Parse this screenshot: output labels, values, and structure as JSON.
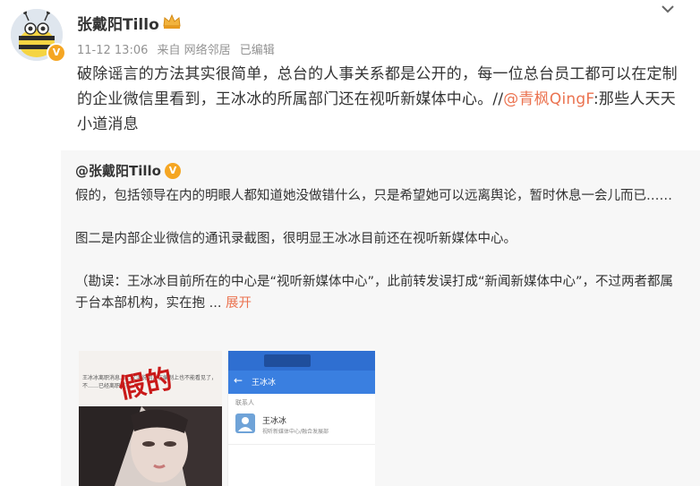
{
  "post": {
    "username": "张戴阳Tillo",
    "timestamp": "11-12 13:06",
    "source": "来自 网络邻居",
    "edited": "已编辑",
    "text_main": "破除谣言的方法其实很简单，总台的人事关系都是公开的，每一位总台员工都可以在定制的企业微信里看到，王冰冰的所属部门还在视听新媒体中心。//",
    "mention": "@青枫QingF",
    "text_after_mention": ":那些人天天小道消息"
  },
  "repost": {
    "username": "@张戴阳Tillo",
    "para1": "假的，包括领导在内的明眼人都知道她没做错什么，只是希望她可以远离舆论，暂时休息一会儿而已……",
    "para2": "图二是内部企业微信的通讯录截图，很明显王冰冰目前还在视听新媒体中心。",
    "para3": "（勘误：王冰冰目前所在的中心是“视听新媒体中心”，此前转发误打成“新闻新媒体中心”，不过两者都属于台本部机构，实在抱 ... ",
    "expand_label": "展开"
  },
  "images": {
    "image1": {
      "stamp": "假的",
      "caption": "王冰冰离职消息……文字说明，在编制上也不能看见了，不……已经离职属实"
    },
    "image2": {
      "header_title": "王冰冰",
      "back_icon": "arrow-left-icon",
      "section_label": "联系人",
      "contact_name": "王冰冰",
      "contact_dept": "视听新媒体中心/融合发展部"
    }
  },
  "icons": {
    "menu": "chevron-down-icon",
    "badge": "crown-badge-icon",
    "verified": "verified-v-icon"
  },
  "colors": {
    "accent": "#eb7350",
    "verified": "#f5a623",
    "repost_bg": "#f7f7f7",
    "wecom_blue": "#3a7fe0"
  }
}
